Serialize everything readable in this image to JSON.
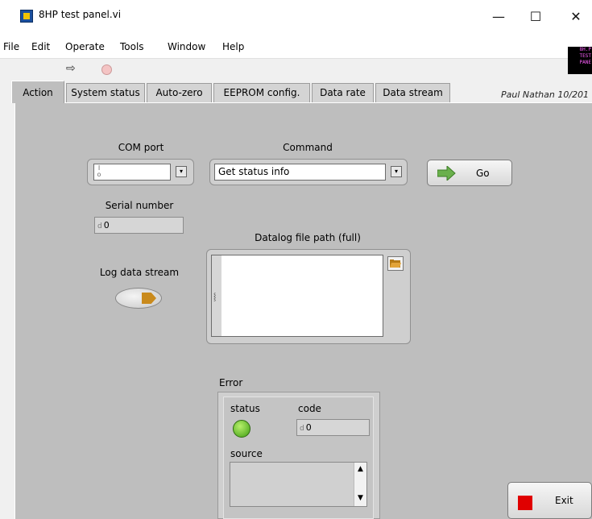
{
  "window": {
    "title": "8HP test panel.vi",
    "minimize": "—",
    "maximize": "☐",
    "close": "✕"
  },
  "menu": {
    "items": [
      "File",
      "Edit",
      "Operate",
      "Tools",
      "Window",
      "Help"
    ]
  },
  "toolbar": {
    "run_icon": "run-arrow-icon",
    "abort_icon": "abort-icon"
  },
  "vi_icon": {
    "lines": [
      "8H.P",
      "TEST",
      "PANE"
    ]
  },
  "tabs": [
    {
      "label": "Action",
      "active": true
    },
    {
      "label": "System status"
    },
    {
      "label": "Auto-zero"
    },
    {
      "label": "EEPROM config."
    },
    {
      "label": "Data rate"
    },
    {
      "label": "Data stream"
    }
  ],
  "author": "Paul Nathan 10/201",
  "com_port": {
    "label": "COM port",
    "radix": "I/O",
    "value": ""
  },
  "command": {
    "label": "Command",
    "value": "Get status info"
  },
  "go_button": {
    "label": "Go"
  },
  "serial_number": {
    "label": "Serial number",
    "radix": "d",
    "value": "0"
  },
  "datalog": {
    "label": "Datalog file path (full)",
    "value": ""
  },
  "log_stream": {
    "label": "Log data stream"
  },
  "error": {
    "label": "Error",
    "status_label": "status",
    "code_label": "code",
    "code_radix": "d",
    "code_value": "0",
    "source_label": "source",
    "source_value": ""
  },
  "exit_button": {
    "label": "Exit"
  },
  "colors": {
    "panel": "#bebebe",
    "status_led": "#5fc61e",
    "exit_indicator": "#e00000",
    "go_arrow": "#6ab04c",
    "toggle_face": "#c98a1c"
  }
}
